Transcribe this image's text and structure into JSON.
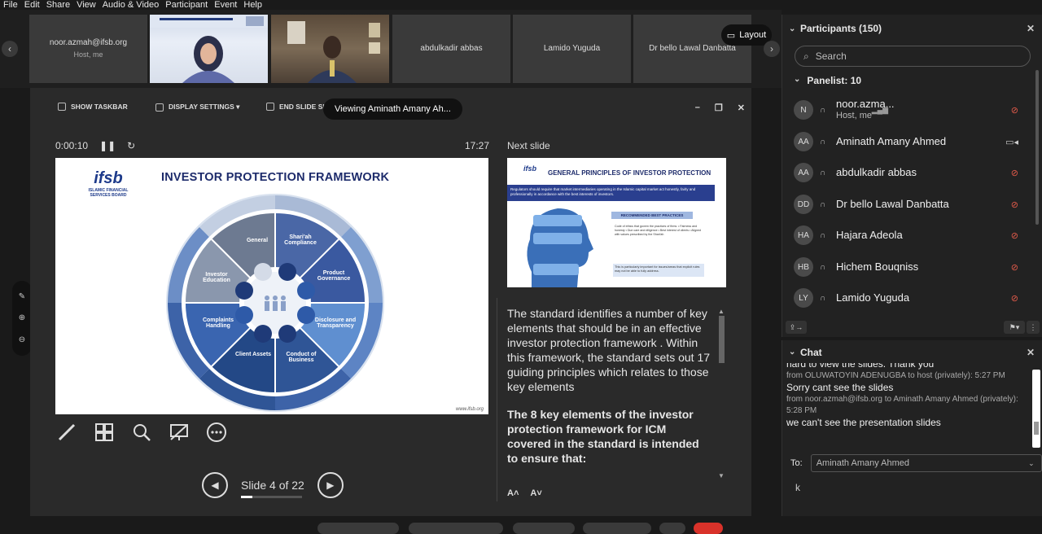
{
  "menu": [
    "File",
    "Edit",
    "Share",
    "View",
    "Audio & Video",
    "Participant",
    "Event",
    "Help"
  ],
  "filmstrip": {
    "tiles": [
      {
        "name": "noor.azmah@ifsb.org",
        "sub": "Host, me"
      },
      {
        "name": "",
        "sub": ""
      },
      {
        "name": "",
        "sub": ""
      },
      {
        "name": "abdulkadir abbas",
        "sub": ""
      },
      {
        "name": "Lamido Yuguda",
        "sub": ""
      },
      {
        "name": "Dr bello Lawal Danbatta",
        "sub": ""
      }
    ],
    "layout_label": "Layout"
  },
  "toolbar": {
    "show_taskbar": "SHOW TASKBAR",
    "display_settings": "DISPLAY SETTINGS ▾",
    "end_slide_show": "END SLIDE SH"
  },
  "viewing": "Viewing Aminath Amany Ah...",
  "presenter": {
    "elapsed": "0:00:10",
    "clock": "17:27",
    "next_label": "Next slide",
    "slide_counter": "Slide 4 of 22",
    "progress": 0.18
  },
  "slide": {
    "title": "INVESTOR PROTECTION FRAMEWORK",
    "logo_text": "ifsb",
    "logo_sub": "ISLAMIC FINANCIAL SERVICES BOARD",
    "footer": "www.ifsb.org",
    "segments": [
      "General",
      "Shari'ah Compliance",
      "Product Governance",
      "Disclosure and Transparency",
      "Conduct of Business",
      "Client Assets",
      "Complaints Handling",
      "Investor Education"
    ]
  },
  "next_slide": {
    "title": "GENERAL PRINCIPLES OF INVESTOR PROTECTION",
    "banner": "Regulators should require that market intermediaries operating in the Islamic capital market act honestly, fairly and professionally in accordance with the best interests of investors.",
    "recommended": "RECOMMENDED BEST PRACTICES",
    "code": "Code of ethics that govern the practices of firms: • Fairness and honesty • Due care and diligence • Best interest of clients • Aligned with values prescribed by the Shari'ah",
    "note": "This is particularly important for issues/areas that explicit rules may not be able to fully address."
  },
  "notes": {
    "para1": "The standard identifies a number of key elements that should be in an effective investor protection framework . Within this framework, the standard sets out 17 guiding principles which relates to those key elements",
    "para2": "The 8 key elements of the investor protection framework for ICM covered in the standard is intended to ensure that:"
  },
  "participants": {
    "title": "Participants (150)",
    "search_placeholder": "Search",
    "panelist_header": "Panelist: 10",
    "list": [
      {
        "initials": "N",
        "name": "noor.azma...",
        "sub": "Host, me",
        "status": "audio-meter"
      },
      {
        "initials": "AA",
        "name": "Aminath Amany Ahmed",
        "sub": "",
        "status": "video"
      },
      {
        "initials": "AA",
        "name": "abdulkadir abbas",
        "sub": "",
        "status": "muted"
      },
      {
        "initials": "DD",
        "name": "Dr bello Lawal Danbatta",
        "sub": "",
        "status": "muted"
      },
      {
        "initials": "HA",
        "name": "Hajara Adeola",
        "sub": "",
        "status": "muted"
      },
      {
        "initials": "HB",
        "name": "Hichem Bouqniss",
        "sub": "",
        "status": "muted"
      },
      {
        "initials": "LY",
        "name": "Lamido Yuguda",
        "sub": "",
        "status": "muted"
      }
    ]
  },
  "chat": {
    "title": "Chat",
    "messages": [
      {
        "meta": "",
        "text": "hard to view the slides. Thank you"
      },
      {
        "meta": "from OLUWATOYIN ADENUGBA to host (privately):    5:27 PM",
        "text": "Sorry cant see the slides"
      },
      {
        "meta": "from noor.azmah@ifsb.org to Aminath Amany Ahmed (privately): 5:28 PM",
        "text": "we can't see the presentation slides"
      }
    ],
    "to_label": "To:",
    "to_value": "Aminath Amany Ahmed",
    "input_value": "k"
  }
}
